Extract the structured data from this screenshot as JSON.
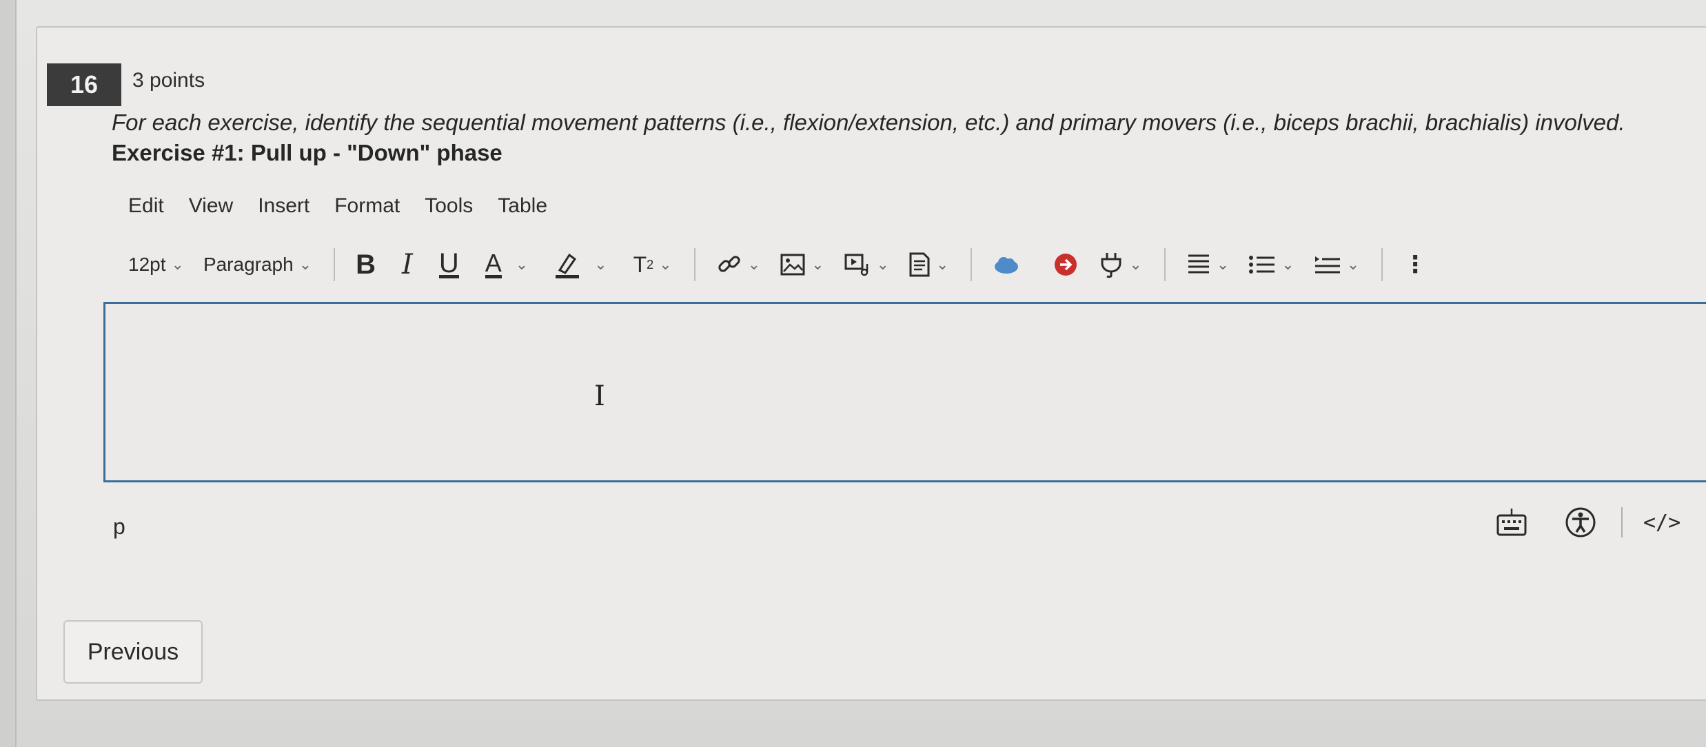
{
  "question": {
    "number": "16",
    "points": "3 points",
    "prompt": "For each exercise, identify the sequential movement patterns (i.e., flexion/extension, etc.) and primary movers (i.e., biceps brachii, brachialis) involved.",
    "exercise": "Exercise #1: Pull up - \"Down\" phase"
  },
  "editor": {
    "menu": [
      "Edit",
      "View",
      "Insert",
      "Format",
      "Tools",
      "Table"
    ],
    "toolbar": {
      "font_size": "12pt",
      "block_format": "Paragraph",
      "bold": "B",
      "italic": "I",
      "underline": "U",
      "text_color": "A",
      "superscript_base": "T",
      "superscript_exp": "2",
      "icons": [
        "chevron-down-icon",
        "link-icon",
        "image-icon",
        "media-icon",
        "document-icon",
        "cloud-icon",
        "arrow-right-circle-icon",
        "plug-icon",
        "align-icon",
        "list-icon",
        "indent-icon",
        "more-vertical-icon"
      ]
    },
    "status_path": "p",
    "html_toggle": "</>",
    "accent_color": "#3a6d9a"
  },
  "navigation": {
    "previous_label": "Previous"
  }
}
